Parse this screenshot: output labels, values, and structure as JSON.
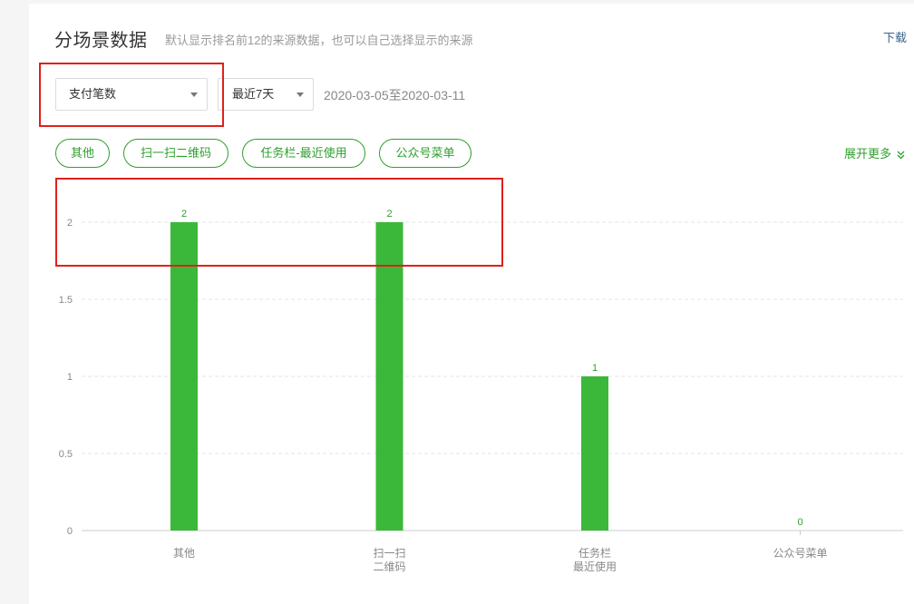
{
  "header": {
    "title": "分场景数据",
    "subtitle": "默认显示排名前12的来源数据，也可以自己选择显示的来源",
    "download_label": "下载"
  },
  "filters": {
    "metric": "支付笔数",
    "range": "最近7天",
    "date_range": "2020-03-05至2020-03-11"
  },
  "chips": [
    "其他",
    "扫一扫二维码",
    "任务栏-最近使用",
    "公众号菜单"
  ],
  "expand_label": "展开更多",
  "colors": {
    "accent": "#3bb83a",
    "highlight": "#e0201b"
  },
  "chart_data": {
    "type": "bar",
    "categories": [
      "其他",
      "扫一扫二维码",
      "任务栏最近使用",
      "公众号菜单"
    ],
    "category_lines": [
      [
        "其他"
      ],
      [
        "扫一扫",
        "二维码"
      ],
      [
        "任务栏",
        "最近使用"
      ],
      [
        "公众号菜单"
      ]
    ],
    "values": [
      2,
      2,
      1,
      0
    ],
    "yticks": [
      "0",
      "0.5",
      "1",
      "1.5",
      "2"
    ],
    "ylim": [
      0,
      2
    ],
    "data_labels": true,
    "grid": true
  }
}
